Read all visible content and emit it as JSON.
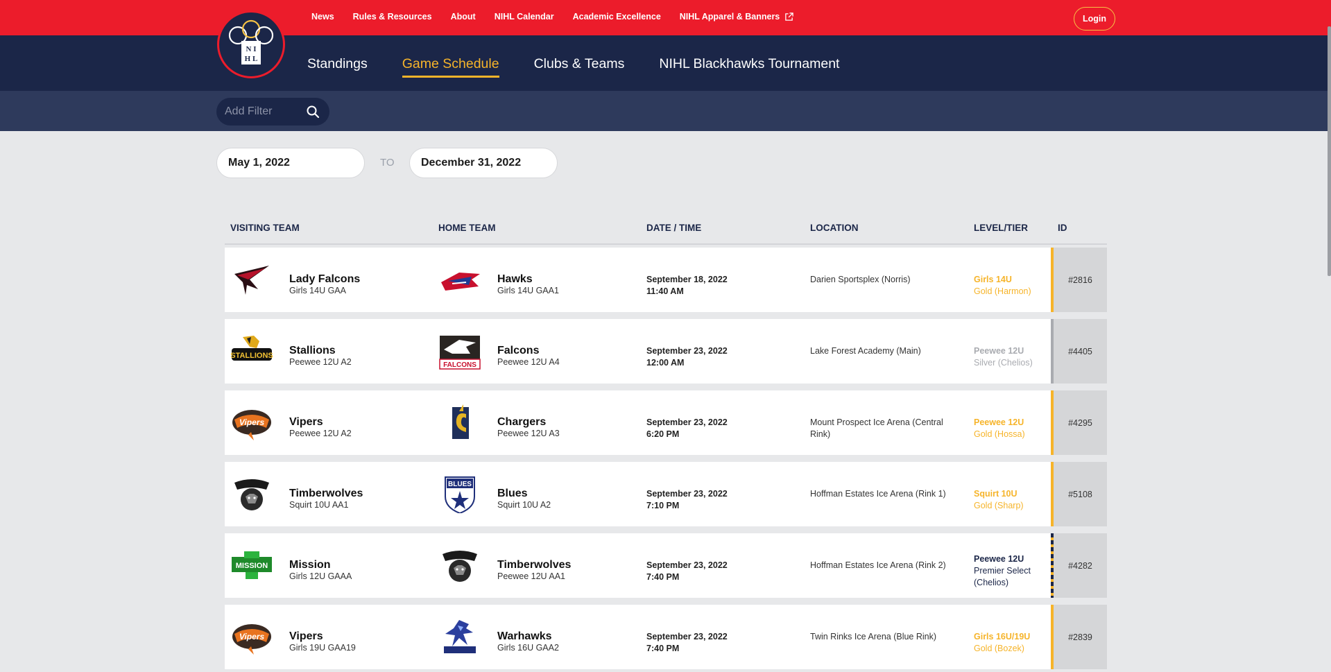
{
  "util_nav": {
    "links": [
      "News",
      "Rules & Resources",
      "About",
      "NIHL Calendar",
      "Academic Excellence",
      "NIHL Apparel & Banners"
    ],
    "login_label": "Login"
  },
  "logo": {
    "letters": "N I H L"
  },
  "main_nav": {
    "links": [
      "Standings",
      "Game Schedule",
      "Clubs & Teams",
      "NIHL Blackhawks Tournament"
    ],
    "active": "Game Schedule"
  },
  "filter": {
    "placeholder": "Add Filter"
  },
  "date_range": {
    "from": "May 1, 2022",
    "separator": "TO",
    "to": "December 31, 2022"
  },
  "table": {
    "headers": {
      "visiting": "VISITING TEAM",
      "home": "HOME TEAM",
      "datetime": "DATE / TIME",
      "location": "LOCATION",
      "level": "LEVEL/TIER",
      "id": "ID"
    },
    "rows": [
      {
        "visiting": {
          "name": "Lady Falcons",
          "sub": "Girls 14U GAA"
        },
        "home": {
          "name": "Hawks",
          "sub": "Girls 14U GAA1"
        },
        "date": "September 18, 2022",
        "time": "11:40 AM",
        "location": "Darien Sportsplex (Norris)",
        "level1": "Girls 14U",
        "level2": "Gold (Harmon)",
        "tier": "gold",
        "id": "#2816"
      },
      {
        "visiting": {
          "name": "Stallions",
          "sub": "Peewee 12U A2"
        },
        "home": {
          "name": "Falcons",
          "sub": "Peewee 12U A4"
        },
        "date": "September 23, 2022",
        "time": "12:00 AM",
        "location": "Lake Forest Academy (Main)",
        "level1": "Peewee 12U",
        "level2": "Silver (Chelios)",
        "tier": "silver",
        "id": "#4405"
      },
      {
        "visiting": {
          "name": "Vipers",
          "sub": "Peewee 12U A2"
        },
        "home": {
          "name": "Chargers",
          "sub": "Peewee 12U A3"
        },
        "date": "September 23, 2022",
        "time": "6:20 PM",
        "location": "Mount Prospect Ice Arena (Central Rink)",
        "level1": "Peewee 12U",
        "level2": "Gold (Hossa)",
        "tier": "gold",
        "id": "#4295"
      },
      {
        "visiting": {
          "name": "Timberwolves",
          "sub": "Squirt 10U AA1"
        },
        "home": {
          "name": "Blues",
          "sub": "Squirt 10U A2"
        },
        "date": "September 23, 2022",
        "time": "7:10 PM",
        "location": "Hoffman Estates Ice Arena (Rink 1)",
        "level1": "Squirt 10U",
        "level2": "Gold (Sharp)",
        "tier": "gold",
        "id": "#5108"
      },
      {
        "visiting": {
          "name": "Mission",
          "sub": "Girls 12U GAAA"
        },
        "home": {
          "name": "Timberwolves",
          "sub": "Peewee 12U AA1"
        },
        "date": "September 23, 2022",
        "time": "7:40 PM",
        "location": "Hoffman Estates Ice Arena (Rink 2)",
        "level1": "Peewee 12U",
        "level2": "Premier Select (Chelios)",
        "tier": "premier",
        "id": "#4282"
      },
      {
        "visiting": {
          "name": "Vipers",
          "sub": "Girls 19U GAA19"
        },
        "home": {
          "name": "Warhawks",
          "sub": "Girls 16U GAA2"
        },
        "date": "September 23, 2022",
        "time": "7:40 PM",
        "location": "Twin Rinks Ice Arena (Blue Rink)",
        "level1": "Girls 16U/19U",
        "level2": "Gold (Bozek)",
        "tier": "gold",
        "id": "#2839"
      }
    ]
  },
  "colors": {
    "red": "#ec1c2b",
    "navy": "#1b2648",
    "gold": "#f6b42a",
    "silver": "#a9abb0"
  }
}
